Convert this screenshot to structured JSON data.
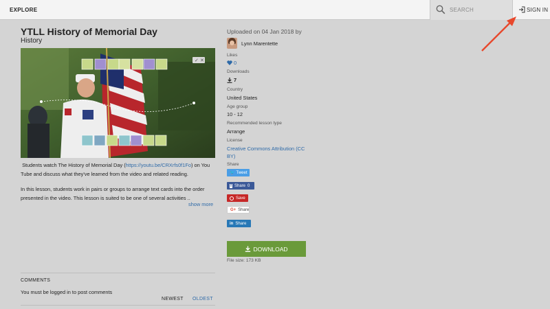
{
  "topbar": {
    "explore_label": "EXPLORE",
    "search_placeholder": "SEARCH",
    "signin_label": "SIGN IN"
  },
  "lesson": {
    "title": "YTLL History of Memorial Day",
    "subject": "History",
    "description_prefix": "Students watch The History of Memorial Day (",
    "description_link": "https://youtu.be/CRXrfs0f1Fo",
    "description_suffix": ") on You Tube and discuss what they've learned from the video and related reading.",
    "description_p2": "In this lesson, students work in pairs or groups to arrange text cards into the order presented in the video.  This lesson is suited to be one of several activities ..",
    "show_more": "show more"
  },
  "comments": {
    "heading": "COMMENTS",
    "note": "You must be logged in to post comments",
    "sort_newest": "NEWEST",
    "sort_oldest": "OLDEST"
  },
  "meta": {
    "uploaded": "Uploaded on 04 Jan 2018 by",
    "author": "Lynn Marentette",
    "likes_label": "Likes",
    "likes_value": "0",
    "downloads_label": "Downloads",
    "downloads_value": "7",
    "country_label": "Country",
    "country_value": "United States",
    "age_label": "Age group",
    "age_value": "10 - 12",
    "type_label": "Recommended lesson type",
    "type_value": "Arrange",
    "license_label": "License",
    "license_value": "Creative Commons Attribution (CC BY)",
    "share_label": "Share"
  },
  "share": {
    "tweet": "Tweet",
    "facebook": "Share",
    "facebook_count": "0",
    "pinterest": "Save",
    "gplus": "Share",
    "linkedin": "Share"
  },
  "download": {
    "label": "DOWNLOAD",
    "file_size": "File size: 173 KB"
  },
  "colors": {
    "accent_link": "#2e6aa8",
    "download_green": "#6a9a3a",
    "annotation_arrow": "#e8482c"
  }
}
